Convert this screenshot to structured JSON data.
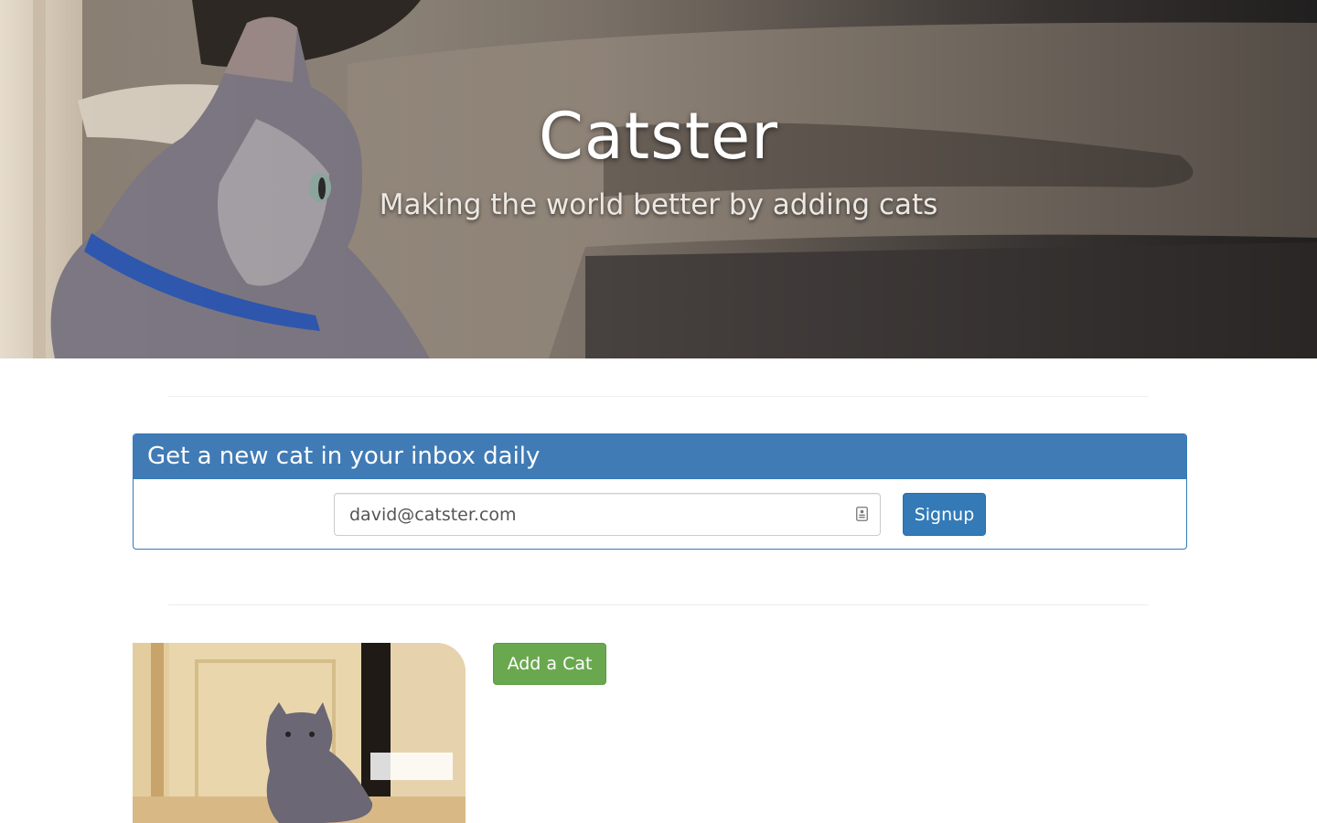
{
  "hero": {
    "title": "Catster",
    "subtitle": "Making the world better by adding cats"
  },
  "signup": {
    "heading": "Get a new cat in your inbox daily",
    "email_value": "david@catster.com",
    "email_placeholder": "david@catster.com",
    "button_label": "Signup"
  },
  "cats": {
    "add_button_label": "Add a Cat"
  },
  "icons": {
    "autofill": "contact-card-icon"
  },
  "colors": {
    "primary": "#337ab7",
    "panel_heading": "#417bb5",
    "success": "#6aa84f",
    "divider": "#eeeeee"
  }
}
